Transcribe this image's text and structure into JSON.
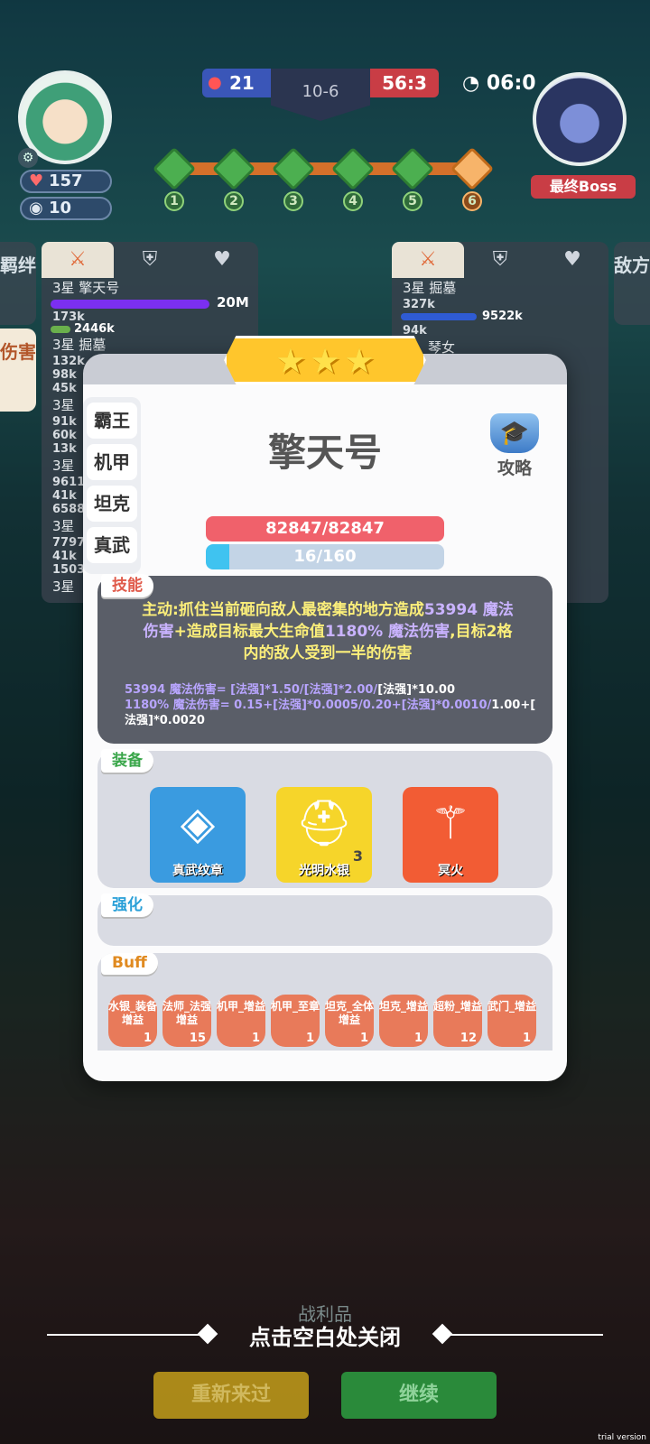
{
  "hud": {
    "hearts": "157",
    "shields": "10",
    "score_left": "21",
    "round": "10-6",
    "score_right": "56:3",
    "timer": "06:0",
    "boss_label": "最终Boss",
    "stages": [
      "1",
      "2",
      "3",
      "4",
      "5",
      "6"
    ]
  },
  "side_tabs": {
    "left_1": "羁绊",
    "left_2": "伤害",
    "right_1": "敌方"
  },
  "left_panel": {
    "rows": [
      {
        "name": "3星 擎天号",
        "value": "20M"
      },
      {
        "name": "173k",
        "value": "2446k"
      },
      {
        "name": "3星 掘墓"
      },
      {
        "name": "132k"
      },
      {
        "name": "98k"
      },
      {
        "name": "45k"
      },
      {
        "name": "3星"
      },
      {
        "name": "91k"
      },
      {
        "name": "60k"
      },
      {
        "name": "13k"
      },
      {
        "name": "3星"
      },
      {
        "name": "9611"
      },
      {
        "name": "41k"
      },
      {
        "name": "6588"
      },
      {
        "name": "3星"
      },
      {
        "name": "7797"
      },
      {
        "name": "41k"
      },
      {
        "name": "1503"
      },
      {
        "name": "3星"
      }
    ]
  },
  "right_panel": {
    "rows": [
      {
        "name": "3星 掘墓"
      },
      {
        "name": "327k",
        "value": "9522k"
      },
      {
        "name": "94k"
      },
      {
        "name": "琴女"
      }
    ]
  },
  "modal": {
    "stars": "★★★",
    "traits": [
      "霸王",
      "机甲",
      "坦克",
      "真武"
    ],
    "hero_name": "擎天号",
    "guide_label": "攻略",
    "hp": "82847/82847",
    "mana": "16/160",
    "mana_fraction": 0.1,
    "skill_tag": "技能",
    "skill_line1_a": "主动:抓住当前砸向敌人最密集的地方造成",
    "skill_line1_b": "53994 魔法",
    "skill_line2_a": "伤害",
    "skill_line2_b": "+造成目标最大生命值",
    "skill_line2_c": "1180% 魔法伤害",
    "skill_line2_d": ",目标2格",
    "skill_line3": "内的敌人受到一半的伤害",
    "formula1_a": "53994 魔法伤害= [法强]*1.50/[法强]*2.00/",
    "formula1_b": "[法强]*10.00",
    "formula2_a": "1180% 魔法伤害= 0.15+[法强]*0.0005/0.20+[法强]*0.0010/",
    "formula2_b": "1.00+[",
    "formula3": "法强]*0.0020",
    "equip_tag": "装备",
    "equipment": [
      {
        "name": "真武纹章",
        "count": ""
      },
      {
        "name": "光明水银",
        "count": "3"
      },
      {
        "name": "冥火",
        "count": ""
      }
    ],
    "enhance_tag": "强化",
    "buff_tag": "Buff",
    "buffs": [
      {
        "name": "水银_装备增益",
        "level": "1"
      },
      {
        "name": "法师_法强增益",
        "level": "15"
      },
      {
        "name": "机甲_增益",
        "level": "1"
      },
      {
        "name": "机甲_至章",
        "level": "1"
      },
      {
        "name": "坦克_全体增益",
        "level": "1"
      },
      {
        "name": "坦克_增益",
        "level": "1"
      },
      {
        "name": "超粉_增益",
        "level": "12"
      },
      {
        "name": "武门_增益",
        "level": "1"
      }
    ]
  },
  "bottom": {
    "close_hint": "点击空白处关闭",
    "loot": "战利品",
    "retry": "重新来过",
    "continue": "继续",
    "trial": "trial version"
  }
}
